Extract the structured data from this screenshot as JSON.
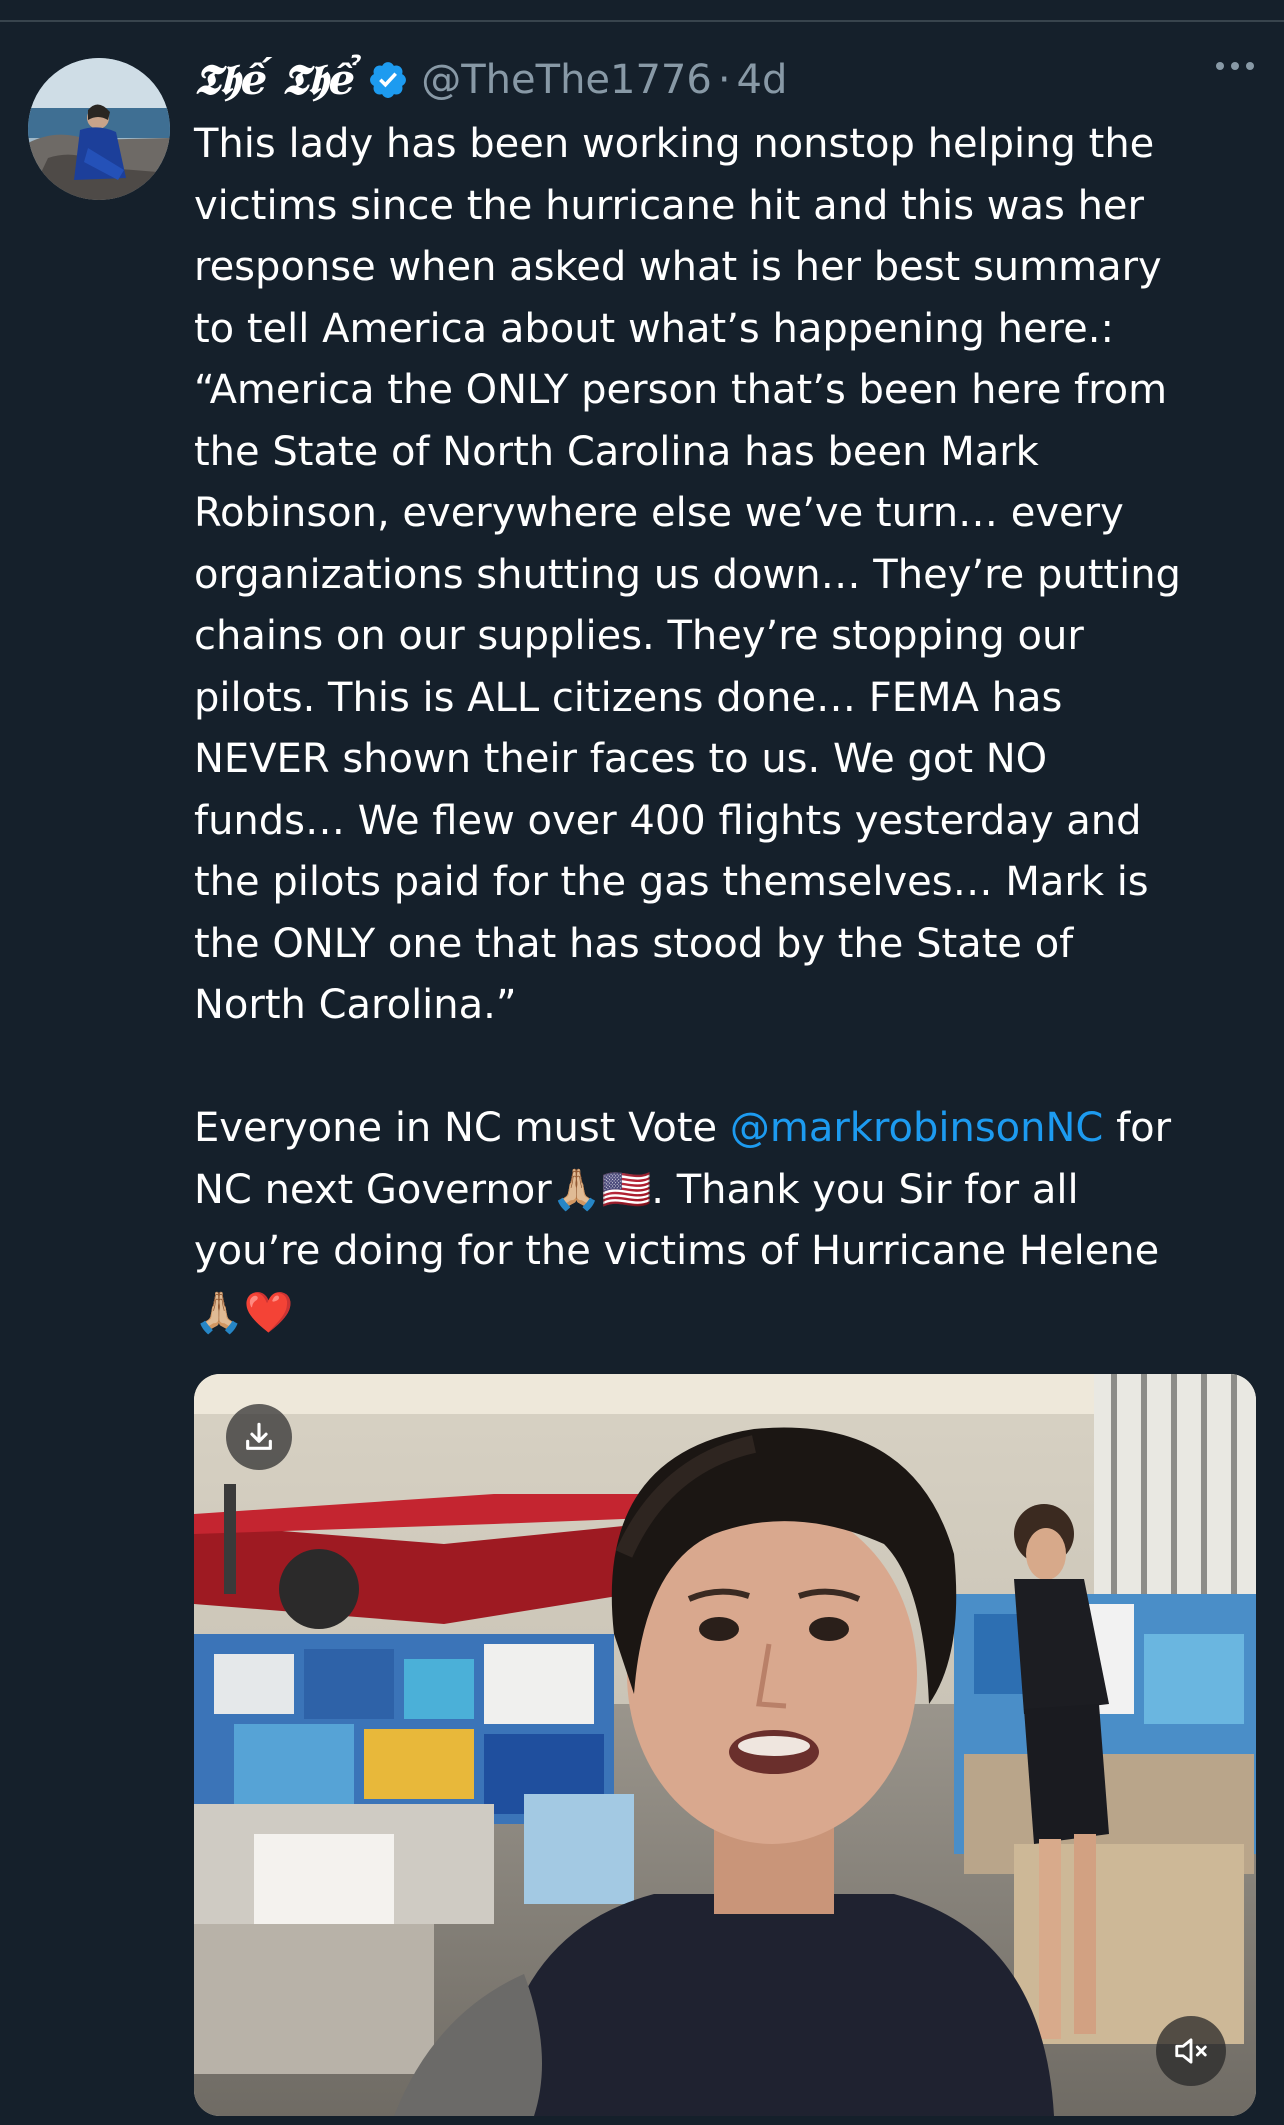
{
  "post": {
    "author": {
      "display_name": "𝕿𝖍ế 𝕿𝖍ể",
      "handle": "@TheThe1776",
      "separator": "·",
      "timestamp": "4d",
      "verified": true
    },
    "text_lines": [
      "This lady has been working nonstop helping the",
      "victims since the hurricane hit and this was her",
      "response when asked what is her best summary",
      "to tell America about what’s happening here.:",
      "“America the ONLY person that’s been here from",
      "the State of North Carolina has been Mark",
      "Robinson, everywhere else we’ve turn… every",
      "organizations shutting us down… They’re putting",
      "chains on our supplies.  They’re stopping our",
      "pilots. This is ALL citizens done… FEMA has",
      "NEVER shown their faces to us.  We got NO",
      "funds… We flew over 400 flights yesterday and",
      "the pilots paid for the gas themselves… Mark is",
      "the ONLY one that has stood by the State of",
      "North Carolina.”"
    ],
    "para2": {
      "line1_before": "Everyone in NC must Vote ",
      "mention": "@markrobinsonNC",
      "line1_after": " for",
      "line2_before": "NC next Governor",
      "line2_emoji_pray": "🙏🏼",
      "line2_emoji_flag": "🇺🇸",
      "line2_after": ". Thank you Sir for all",
      "line3": "you’re doing for the victims of Hurricane Helene",
      "line4_emoji_pray": "🙏🏼",
      "line4_emoji_heart": "❤️"
    },
    "media": {
      "type": "video",
      "download_icon": "download-icon",
      "mute_icon": "speaker-muted-icon"
    }
  },
  "colors": {
    "background": "#15202b",
    "text": "#ffffff",
    "secondary": "#8899a6",
    "link": "#1d9bf0",
    "verified": "#1d9bf0"
  }
}
